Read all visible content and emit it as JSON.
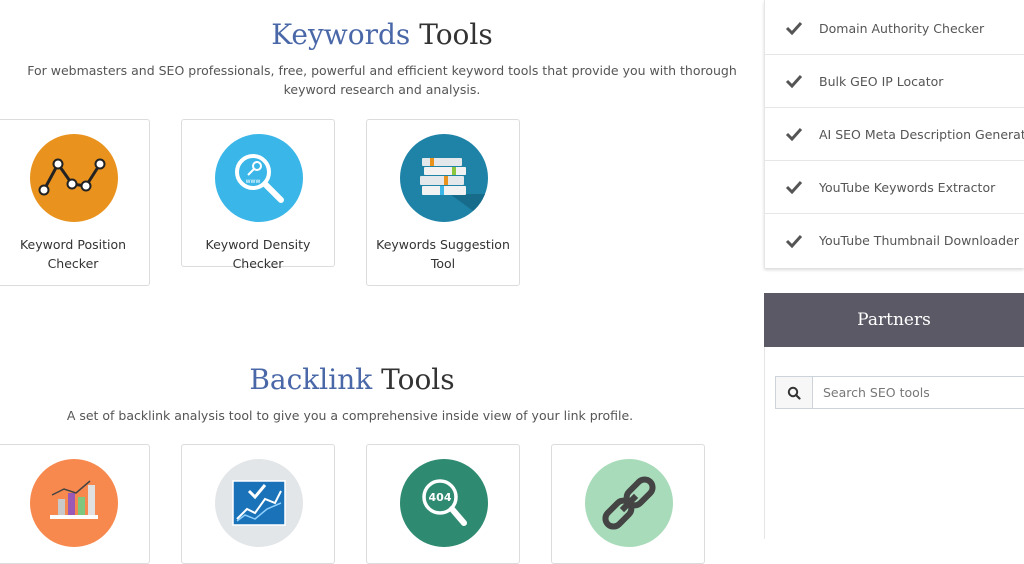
{
  "keywords_section": {
    "title_accent": "Keywords",
    "title_rest": " Tools",
    "description_line1": "For webmasters and SEO professionals, free, powerful and efficient keyword tools that provide you with thorough",
    "description_line2": "keyword research and analysis.",
    "tools": [
      {
        "label_line1": "Keyword Position",
        "label_line2": "Checker",
        "icon": "keyword-position-icon",
        "color": "#e9931e"
      },
      {
        "label_line1": "Keyword Density Checker",
        "label_line2": "",
        "icon": "keyword-density-icon",
        "color": "#3ab7e8"
      },
      {
        "label_line1": "Keywords Suggestion",
        "label_line2": "Tool",
        "icon": "keywords-suggestion-icon",
        "color": "#1f83a8"
      }
    ]
  },
  "backlink_section": {
    "title_accent": "Backlink",
    "title_rest": " Tools",
    "description": "A set of backlink analysis tool to give you a comprehensive inside view of your link profile.",
    "tools": [
      {
        "icon": "backlink-chart-icon",
        "color": "#f7894e"
      },
      {
        "icon": "growth-chart-icon",
        "color": "#e3e6e8"
      },
      {
        "icon": "broken-link-404-icon",
        "color": "#2e8a70",
        "badge": "404"
      },
      {
        "icon": "chain-link-icon",
        "color": "#a8dbb9"
      }
    ]
  },
  "sidebar": {
    "tools": [
      {
        "label": "Domain Authority Checker"
      },
      {
        "label": "Bulk GEO IP Locator"
      },
      {
        "label": "AI SEO Meta Description Generator"
      },
      {
        "label": "YouTube Keywords Extractor"
      },
      {
        "label": "YouTube Thumbnail Downloader"
      }
    ],
    "partners_title": "Partners",
    "search_placeholder": "Search SEO tools"
  }
}
